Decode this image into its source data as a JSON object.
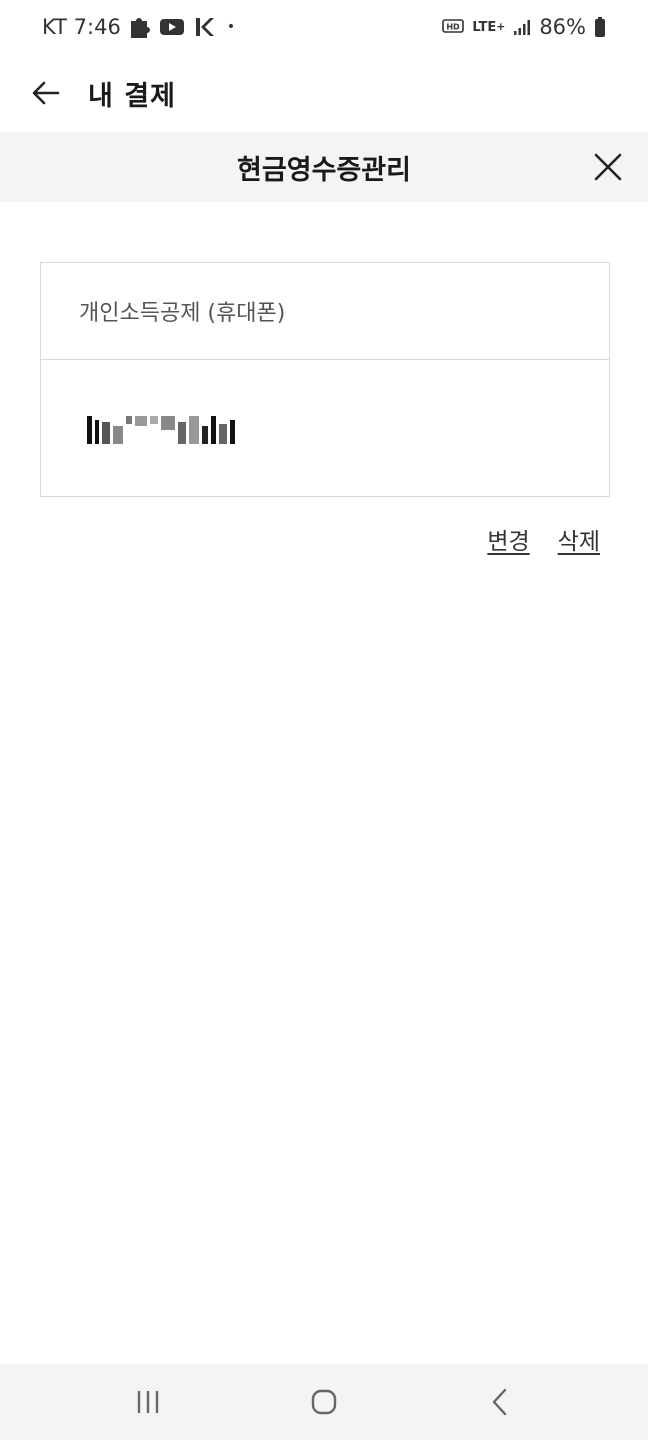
{
  "status_bar": {
    "carrier_time": "KT 7:46",
    "separator": "•",
    "network": "LTE",
    "battery": "86%",
    "icons": [
      "puzzle-icon",
      "youtube-icon",
      "k-app-icon",
      "hd-call-icon",
      "lte-plus-icon",
      "signal-icon",
      "battery-icon"
    ]
  },
  "header": {
    "title": "내 결제",
    "back_icon": "back-arrow-icon"
  },
  "modal": {
    "title": "현금영수증관리",
    "close_icon": "close-icon"
  },
  "receipt": {
    "type_label": "개인소득공제 (휴대폰)",
    "number_display": "masked"
  },
  "actions": {
    "change_label": "변경",
    "delete_label": "삭제"
  },
  "nav_bar": {
    "recent_icon": "recent-apps-icon",
    "home_icon": "home-icon",
    "back_icon": "nav-back-icon"
  },
  "colors": {
    "band_background": "#f4f4f4",
    "border": "#d9d9d9",
    "text_primary": "#1a1a1a"
  }
}
